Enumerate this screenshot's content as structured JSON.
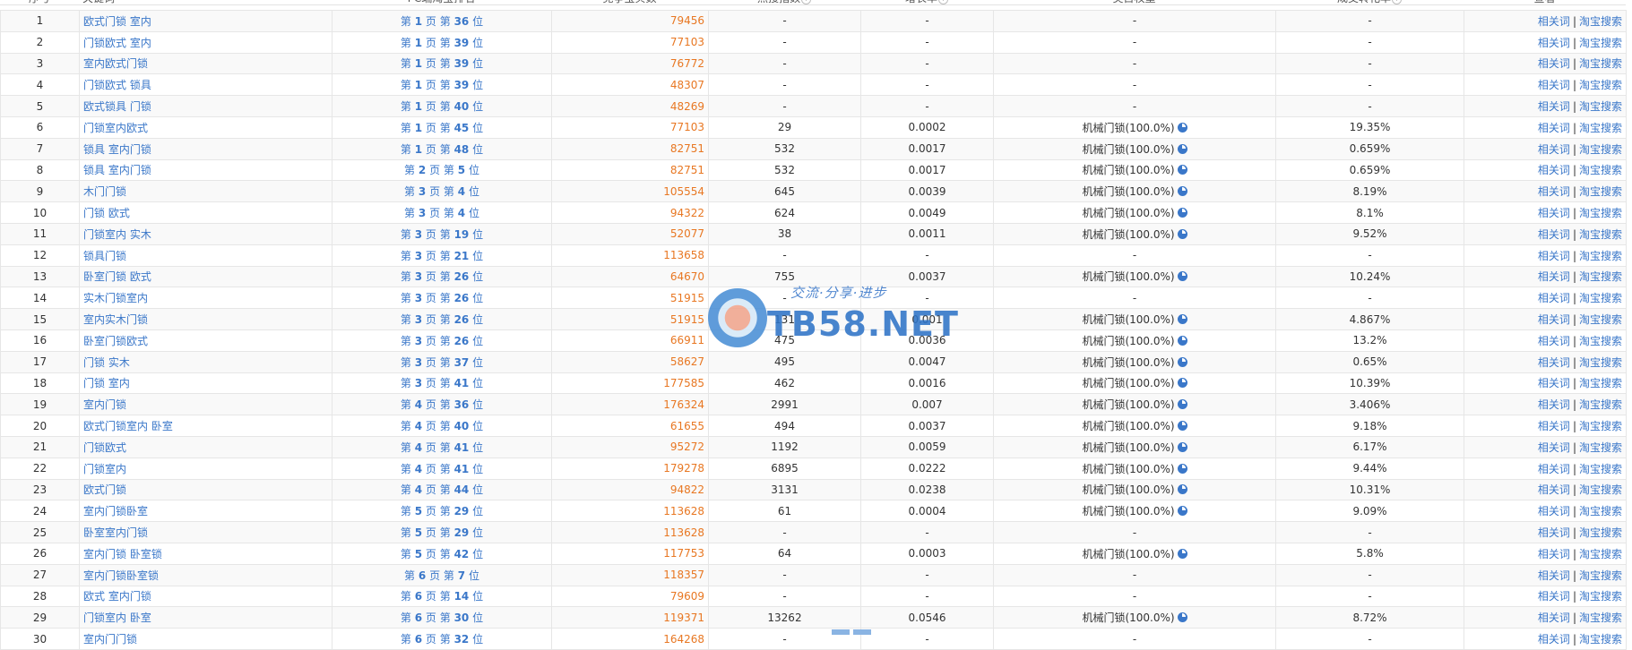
{
  "table": {
    "headers": [
      {
        "label": "序号",
        "help": false
      },
      {
        "label": "关键词",
        "help": false
      },
      {
        "label": "PC端淘宝排名",
        "help": false
      },
      {
        "label": "竞争宝贝数",
        "help": false
      },
      {
        "label": "热搜指数",
        "help": true
      },
      {
        "label": "增长率",
        "help": true
      },
      {
        "label": "类目权重",
        "help": false
      },
      {
        "label": "成交转化率",
        "help": true
      },
      {
        "label": "查看",
        "help": false
      }
    ],
    "help_glyph": "?",
    "rank_tokens": {
      "page_prefix": "第",
      "page_suffix": "页",
      "pos_prefix": "第",
      "pos_suffix": "位"
    },
    "actions": {
      "related": "相关词",
      "separator": "|",
      "search": "淘宝搜索"
    },
    "rows": [
      {
        "idx": "1",
        "keyword": "欧式门锁 室内",
        "page": "1",
        "pos": "36",
        "competitors": "79456",
        "heat": "-",
        "growth": "-",
        "category": "-",
        "conversion": "-"
      },
      {
        "idx": "2",
        "keyword": "门锁欧式 室内",
        "page": "1",
        "pos": "39",
        "competitors": "77103",
        "heat": "-",
        "growth": "-",
        "category": "-",
        "conversion": "-"
      },
      {
        "idx": "3",
        "keyword": "室内欧式门锁",
        "page": "1",
        "pos": "39",
        "competitors": "76772",
        "heat": "-",
        "growth": "-",
        "category": "-",
        "conversion": "-"
      },
      {
        "idx": "4",
        "keyword": "门锁欧式 锁具",
        "page": "1",
        "pos": "39",
        "competitors": "48307",
        "heat": "-",
        "growth": "-",
        "category": "-",
        "conversion": "-"
      },
      {
        "idx": "5",
        "keyword": "欧式锁具 门锁",
        "page": "1",
        "pos": "40",
        "competitors": "48269",
        "heat": "-",
        "growth": "-",
        "category": "-",
        "conversion": "-"
      },
      {
        "idx": "6",
        "keyword": "门锁室内欧式",
        "page": "1",
        "pos": "45",
        "competitors": "77103",
        "heat": "29",
        "growth": "0.0002",
        "category": "机械门锁(100.0%)",
        "conversion": "19.35%"
      },
      {
        "idx": "7",
        "keyword": "锁具 室内门锁",
        "page": "1",
        "pos": "48",
        "competitors": "82751",
        "heat": "532",
        "growth": "0.0017",
        "category": "机械门锁(100.0%)",
        "conversion": "0.659%"
      },
      {
        "idx": "8",
        "keyword": "锁具 室内门锁",
        "page": "2",
        "pos": "5",
        "competitors": "82751",
        "heat": "532",
        "growth": "0.0017",
        "category": "机械门锁(100.0%)",
        "conversion": "0.659%"
      },
      {
        "idx": "9",
        "keyword": "木门门锁",
        "page": "3",
        "pos": "4",
        "competitors": "105554",
        "heat": "645",
        "growth": "0.0039",
        "category": "机械门锁(100.0%)",
        "conversion": "8.19%"
      },
      {
        "idx": "10",
        "keyword": "门锁 欧式",
        "page": "3",
        "pos": "4",
        "competitors": "94322",
        "heat": "624",
        "growth": "0.0049",
        "category": "机械门锁(100.0%)",
        "conversion": "8.1%"
      },
      {
        "idx": "11",
        "keyword": "门锁室内 实木",
        "page": "3",
        "pos": "19",
        "competitors": "52077",
        "heat": "38",
        "growth": "0.0011",
        "category": "机械门锁(100.0%)",
        "conversion": "9.52%"
      },
      {
        "idx": "12",
        "keyword": "锁具门锁",
        "page": "3",
        "pos": "21",
        "competitors": "113658",
        "heat": "-",
        "growth": "-",
        "category": "-",
        "conversion": "-"
      },
      {
        "idx": "13",
        "keyword": "卧室门锁 欧式",
        "page": "3",
        "pos": "26",
        "competitors": "64670",
        "heat": "755",
        "growth": "0.0037",
        "category": "机械门锁(100.0%)",
        "conversion": "10.24%"
      },
      {
        "idx": "14",
        "keyword": "实木门锁室内",
        "page": "3",
        "pos": "26",
        "competitors": "51915",
        "heat": "-",
        "growth": "-",
        "category": "-",
        "conversion": "-"
      },
      {
        "idx": "15",
        "keyword": "室内实木门锁",
        "page": "3",
        "pos": "26",
        "competitors": "51915",
        "heat": "131",
        "growth": "0.001",
        "category": "机械门锁(100.0%)",
        "conversion": "4.867%"
      },
      {
        "idx": "16",
        "keyword": "卧室门锁欧式",
        "page": "3",
        "pos": "26",
        "competitors": "66911",
        "heat": "475",
        "growth": "0.0036",
        "category": "机械门锁(100.0%)",
        "conversion": "13.2%"
      },
      {
        "idx": "17",
        "keyword": "门锁 实木",
        "page": "3",
        "pos": "37",
        "competitors": "58627",
        "heat": "495",
        "growth": "0.0047",
        "category": "机械门锁(100.0%)",
        "conversion": "0.65%"
      },
      {
        "idx": "18",
        "keyword": "门锁 室内",
        "page": "3",
        "pos": "41",
        "competitors": "177585",
        "heat": "462",
        "growth": "0.0016",
        "category": "机械门锁(100.0%)",
        "conversion": "10.39%"
      },
      {
        "idx": "19",
        "keyword": "室内门锁",
        "page": "4",
        "pos": "36",
        "competitors": "176324",
        "heat": "2991",
        "growth": "0.007",
        "category": "机械门锁(100.0%)",
        "conversion": "3.406%"
      },
      {
        "idx": "20",
        "keyword": "欧式门锁室内 卧室",
        "page": "4",
        "pos": "40",
        "competitors": "61655",
        "heat": "494",
        "growth": "0.0037",
        "category": "机械门锁(100.0%)",
        "conversion": "9.18%"
      },
      {
        "idx": "21",
        "keyword": "门锁欧式",
        "page": "4",
        "pos": "41",
        "competitors": "95272",
        "heat": "1192",
        "growth": "0.0059",
        "category": "机械门锁(100.0%)",
        "conversion": "6.17%"
      },
      {
        "idx": "22",
        "keyword": "门锁室内",
        "page": "4",
        "pos": "41",
        "competitors": "179278",
        "heat": "6895",
        "growth": "0.0222",
        "category": "机械门锁(100.0%)",
        "conversion": "9.44%"
      },
      {
        "idx": "23",
        "keyword": "欧式门锁",
        "page": "4",
        "pos": "44",
        "competitors": "94822",
        "heat": "3131",
        "growth": "0.0238",
        "category": "机械门锁(100.0%)",
        "conversion": "10.31%"
      },
      {
        "idx": "24",
        "keyword": "室内门锁卧室",
        "page": "5",
        "pos": "29",
        "competitors": "113628",
        "heat": "61",
        "growth": "0.0004",
        "category": "机械门锁(100.0%)",
        "conversion": "9.09%"
      },
      {
        "idx": "25",
        "keyword": "卧室室内门锁",
        "page": "5",
        "pos": "29",
        "competitors": "113628",
        "heat": "-",
        "growth": "-",
        "category": "-",
        "conversion": "-"
      },
      {
        "idx": "26",
        "keyword": "室内门锁 卧室锁",
        "page": "5",
        "pos": "42",
        "competitors": "117753",
        "heat": "64",
        "growth": "0.0003",
        "category": "机械门锁(100.0%)",
        "conversion": "5.8%"
      },
      {
        "idx": "27",
        "keyword": "室内门锁卧室锁",
        "page": "6",
        "pos": "7",
        "competitors": "118357",
        "heat": "-",
        "growth": "-",
        "category": "-",
        "conversion": "-"
      },
      {
        "idx": "28",
        "keyword": "欧式 室内门锁",
        "page": "6",
        "pos": "14",
        "competitors": "79609",
        "heat": "-",
        "growth": "-",
        "category": "-",
        "conversion": "-"
      },
      {
        "idx": "29",
        "keyword": "门锁室内 卧室",
        "page": "6",
        "pos": "30",
        "competitors": "119371",
        "heat": "13262",
        "growth": "0.0546",
        "category": "机械门锁(100.0%)",
        "conversion": "8.72%"
      },
      {
        "idx": "30",
        "keyword": "室内门门锁",
        "page": "6",
        "pos": "32",
        "competitors": "164268",
        "heat": "-",
        "growth": "-",
        "category": "-",
        "conversion": "-"
      }
    ]
  },
  "watermark": {
    "slogan": "交流·分享·进步",
    "brand": "TB58.NET"
  },
  "colors": {
    "link": "#3a77c9",
    "competitors": "#e87722",
    "border": "#e6e6e6"
  },
  "icons": {
    "category_pie": "pie-chart-icon",
    "header_help": "question-circle-icon",
    "watermark_logo": "hand-icon"
  }
}
